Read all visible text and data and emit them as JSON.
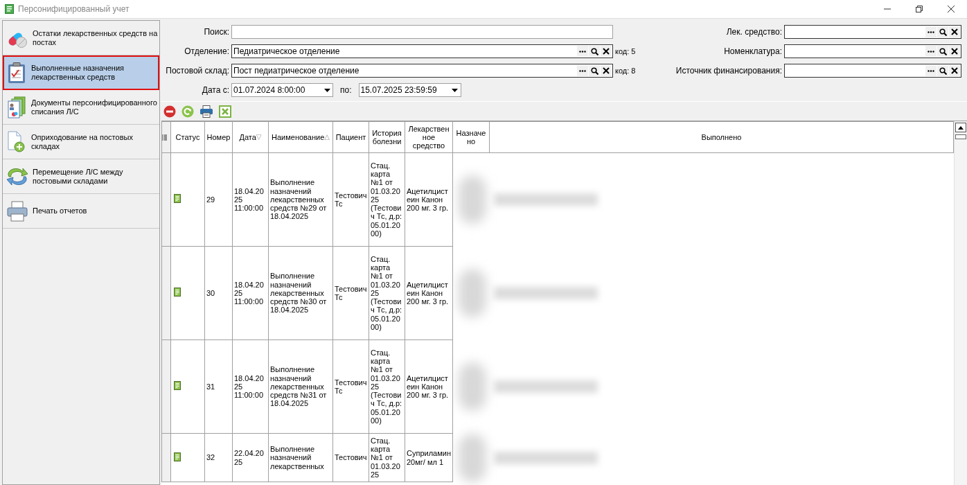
{
  "window": {
    "title": "Персонифицированный учет"
  },
  "sidebar": {
    "items": [
      {
        "label": "Остатки лекарственных средств на постах",
        "kind": "pills",
        "selected": false
      },
      {
        "label": "Выполненные назначения лекарственных средств",
        "kind": "clipboard",
        "selected": true
      },
      {
        "label": "Документы персонифицированного списания Л/С",
        "kind": "documents",
        "selected": false
      },
      {
        "label": "Оприходование на постовых складах",
        "kind": "add-document",
        "selected": false
      },
      {
        "label": "Перемещение Л/С между постовыми складами",
        "kind": "transfer",
        "selected": false
      },
      {
        "label": "Печать отчетов",
        "kind": "printer",
        "selected": false
      }
    ]
  },
  "filters": {
    "search": {
      "label": "Поиск:"
    },
    "lookups": [
      {
        "label": "Отделение:",
        "value": "Педиатрическое отделение",
        "code": "код: 5"
      },
      {
        "label": "Постовой склад:",
        "value": "Пост педиатрическое отделение",
        "code": "код: 8"
      }
    ],
    "date_from": {
      "label": "Дата с:",
      "value": "01.07.2024 8:00:00"
    },
    "date_to": {
      "label": "по:",
      "value": "15.07.2025 23:59:59"
    },
    "right_lookups": [
      {
        "label": "Лек. средство:"
      },
      {
        "label": "Номенклатура:"
      },
      {
        "label": "Источник финансирования:"
      }
    ]
  },
  "table": {
    "columns": [
      {
        "label": "Статус"
      },
      {
        "label": "Номер"
      },
      {
        "label": "Дата",
        "sort_mark": "▽"
      },
      {
        "label": "Наименование",
        "sort_mark": "△"
      },
      {
        "label": "Пациент"
      },
      {
        "label": "История болезни"
      },
      {
        "label": "Лекарственное средство"
      },
      {
        "label": "Назначено"
      },
      {
        "label": "Выполнено"
      }
    ],
    "rows": [
      {
        "kind": "completed",
        "number": "29",
        "date": "18.04.2025 11:00:00",
        "name": "Выполнение назначений лекарственных средств №29 от 18.04.2025",
        "patient": "Тестович Тс",
        "history": "Стац. карта №1 от 01.03.2025 (Тестович Тс, д.р: 05.01.2000)",
        "drug": "Ацетилцистеин Канон 200 мг. 3 гр."
      },
      {
        "kind": "completed",
        "number": "30",
        "date": "18.04.2025 11:00:00",
        "name": "Выполнение назначений лекарственных средств №30 от 18.04.2025",
        "patient": "Тестович Тс",
        "history": "Стац. карта №1 от 01.03.2025 (Тестович Тс, д.р: 05.01.2000)",
        "drug": "Ацетилцистеин Канон 200 мг. 3 гр."
      },
      {
        "kind": "completed",
        "number": "31",
        "date": "18.04.2025 11:00:00",
        "name": "Выполнение назначений лекарственных средств №31 от 18.04.2025",
        "patient": "Тестович Тс",
        "history": "Стац. карта №1 от 01.03.2025 (Тестович Тс, д.р: 05.01.2000)",
        "drug": "Ацетилцистеин Канон 200 мг. 3 гр."
      },
      {
        "kind": "completed",
        "number": "32",
        "date": "22.04.2025",
        "name": "Выполнение назначений лекарственных",
        "patient": "Тестович",
        "history": "Стац. карта №1 от 01.03.2025",
        "drug": "Суприламин 20мг/ мл 1"
      }
    ]
  }
}
